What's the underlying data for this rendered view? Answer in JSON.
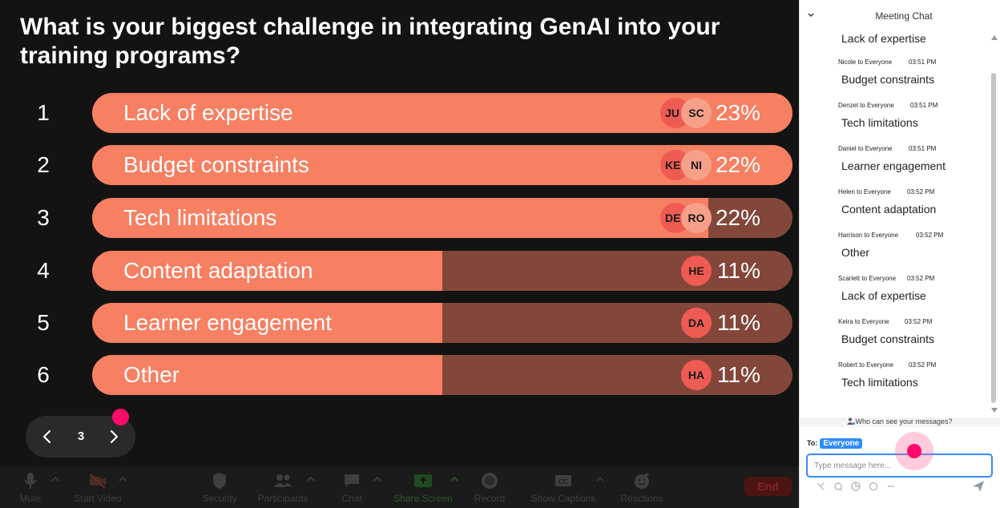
{
  "poll": {
    "question": "What is your biggest challenge in integrating GenAI into your training programs?",
    "options": [
      {
        "rank": "1",
        "label": "Lack of expertise",
        "percent": "23%",
        "fill": 1.0,
        "avatars": [
          "JU",
          "SC"
        ]
      },
      {
        "rank": "2",
        "label": "Budget constraints",
        "percent": "22%",
        "fill": 1.0,
        "avatars": [
          "KE",
          "NI"
        ]
      },
      {
        "rank": "3",
        "label": "Tech limitations",
        "percent": "22%",
        "fill": 0.88,
        "avatars": [
          "DE",
          "RO"
        ]
      },
      {
        "rank": "4",
        "label": "Content adaptation",
        "percent": "11%",
        "fill": 0.5,
        "avatars": [
          "HE"
        ]
      },
      {
        "rank": "5",
        "label": "Learner engagement",
        "percent": "11%",
        "fill": 0.5,
        "avatars": [
          "DA"
        ]
      },
      {
        "rank": "6",
        "label": "Other",
        "percent": "11%",
        "fill": 0.5,
        "avatars": [
          "HA"
        ]
      }
    ],
    "page": "3"
  },
  "toolbar": {
    "mute": "Mute",
    "start_video": "Start Video",
    "security": "Security",
    "participants": "Participants",
    "chat": "Chat",
    "share_screen": "Share Screen",
    "record": "Record",
    "show_captions": "Show Captions",
    "reactions": "Reactions",
    "end": "End"
  },
  "chat": {
    "title": "Meeting Chat",
    "first_message": "Lack of expertise",
    "messages": [
      {
        "meta": "Nicole to Everyone",
        "time": "03:51 PM",
        "text": "Budget constraints"
      },
      {
        "meta": "Denzel to Everyone",
        "time": "03:51 PM",
        "text": "Tech limitations"
      },
      {
        "meta": "Daniel to Everyone",
        "time": "03:51 PM",
        "text": "Learner engagement"
      },
      {
        "meta": "Helen to Everyone",
        "time": "03:52 PM",
        "text": "Content adaptation"
      },
      {
        "meta": "Harrison to Everyone",
        "time": "03:52 PM",
        "text": "Other"
      },
      {
        "meta": "Scarlett to Everyone",
        "time": "03:52 PM",
        "text": "Lack of expertise"
      },
      {
        "meta": "Keira to Everyone",
        "time": "03:52 PM",
        "text": "Budget constraints"
      },
      {
        "meta": "Robert to Everyone",
        "time": "03:52 PM",
        "text": "Tech limitations"
      }
    ],
    "visibility": "Who can see your messages?",
    "to_label": "To:",
    "recipient": "Everyone",
    "input_placeholder": "Type message here..."
  },
  "colors": {
    "bar_fill": "#f77f62",
    "bar_track": "#83473a",
    "accent_pink": "#fe0a6b",
    "chip_blue": "#2e8cff"
  }
}
